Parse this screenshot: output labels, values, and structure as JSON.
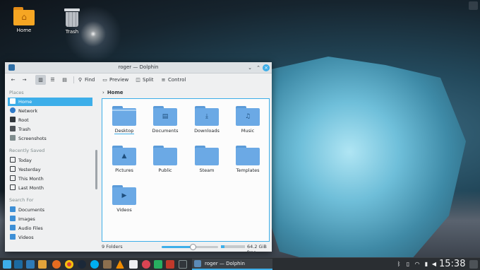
{
  "desktop": {
    "icons": [
      {
        "label": "Home",
        "icon": "home-folder-icon"
      },
      {
        "label": "Trash",
        "icon": "trash-icon"
      }
    ]
  },
  "window": {
    "title": "roger — Dolphin",
    "controls": {
      "minimize": "⌄",
      "maximize": "⌃",
      "close": "×"
    }
  },
  "toolbar": {
    "back": "←",
    "forward": "→",
    "view_icons": "▥",
    "view_compact": "☰",
    "view_details": "▤",
    "find": "Find",
    "preview": "Preview",
    "split": "Split",
    "control": "Control"
  },
  "sidebar": {
    "sections": [
      {
        "title": "Places",
        "items": [
          {
            "label": "Home",
            "active": true,
            "color": "#3d8fd6"
          },
          {
            "label": "Network",
            "color": "#2f7ac9"
          },
          {
            "label": "Root",
            "color": "#31363b"
          },
          {
            "label": "Trash",
            "color": "#31363b"
          },
          {
            "label": "Screenshots",
            "color": "#7f8c8d"
          }
        ]
      },
      {
        "title": "Recently Saved",
        "items": [
          {
            "label": "Today"
          },
          {
            "label": "Yesterday"
          },
          {
            "label": "This Month"
          },
          {
            "label": "Last Month"
          }
        ]
      },
      {
        "title": "Search For",
        "items": [
          {
            "label": "Documents",
            "color": "#3d8fd6"
          },
          {
            "label": "Images",
            "color": "#3d8fd6"
          },
          {
            "label": "Audio Files",
            "color": "#3d8fd6"
          },
          {
            "label": "Videos",
            "color": "#3d8fd6"
          }
        ]
      }
    ]
  },
  "location": {
    "chevron": "›",
    "path": "Home"
  },
  "files": [
    {
      "label": "Desktop",
      "glyph": ""
    },
    {
      "label": "Documents",
      "glyph": "▤"
    },
    {
      "label": "Downloads",
      "glyph": "⤓"
    },
    {
      "label": "Music",
      "glyph": "♫"
    },
    {
      "label": "Pictures",
      "glyph": "▲"
    },
    {
      "label": "Public",
      "glyph": ""
    },
    {
      "label": "Steam",
      "glyph": ""
    },
    {
      "label": "Templates",
      "glyph": ""
    },
    {
      "label": "Videos",
      "glyph": "▶"
    }
  ],
  "status": {
    "count": "9 Folders",
    "zoom_level": 0.55,
    "free_space": "64.2 GiB free",
    "used_fraction": 0.15
  },
  "taskbar": {
    "launchers": [
      "launcher-menu-icon",
      "files-icon",
      "dolphin-icon",
      "folder-icon",
      "firefox-icon",
      "chrome-icon",
      "steam-icon",
      "skype-icon",
      "gimp-icon",
      "vlc-icon",
      "document-icon",
      "record-icon",
      "image-viewer-icon",
      "krita-icon",
      "terminal-icon"
    ],
    "task": {
      "label": "roger — Dolphin"
    },
    "clock": "15:38"
  }
}
